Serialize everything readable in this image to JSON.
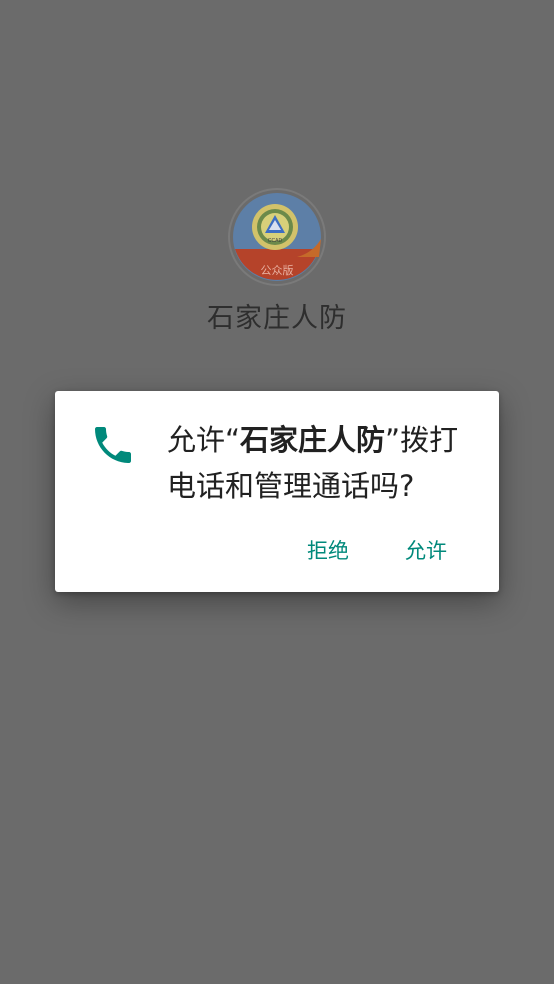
{
  "app": {
    "name": "石家庄人防",
    "logo_text": "公众版",
    "logo_badge_text": "CCAD"
  },
  "dialog": {
    "icon": "phone-icon",
    "message_prefix": "允许“",
    "message_app": "石家庄人防",
    "message_suffix": "”拨打电话和管理通话吗?",
    "deny_label": "拒绝",
    "allow_label": "允许"
  },
  "colors": {
    "scrim": "#6b6b6b",
    "accent": "#00897b",
    "dialog_bg": "#ffffff"
  }
}
